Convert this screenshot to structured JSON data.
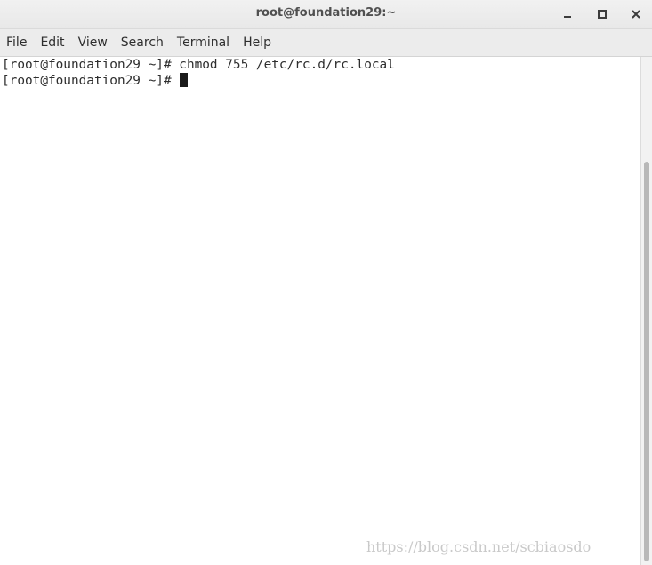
{
  "window": {
    "title": "root@foundation29:~",
    "controls": {
      "minimize_icon": "minimize-icon",
      "maximize_icon": "maximize-icon",
      "close_icon": "close-icon"
    }
  },
  "menu": {
    "items": [
      "File",
      "Edit",
      "View",
      "Search",
      "Terminal",
      "Help"
    ]
  },
  "terminal": {
    "lines": [
      {
        "prompt": "[root@foundation29 ~]# ",
        "command": "chmod 755 /etc/rc.d/rc.local"
      },
      {
        "prompt": "[root@foundation29 ~]# ",
        "command": ""
      }
    ]
  },
  "watermark": "https://blog.csdn.net/scbiaosdo"
}
